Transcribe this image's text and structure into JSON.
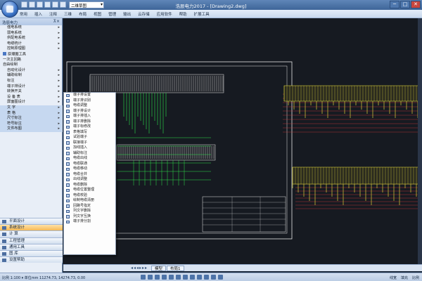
{
  "titlebar": {
    "workspace": "二维草图",
    "title": "浩辰电力2017 - [Drawing2.dwg]",
    "controls": [
      "─",
      "□",
      "✕"
    ]
  },
  "menubar": {
    "items": [
      "常用",
      "插入",
      "注释",
      "三维",
      "布局",
      "视图",
      "管理",
      "输出",
      "云存储",
      "应用软件",
      "帮助",
      "扩展工具"
    ]
  },
  "left_panel": {
    "title": "浩辰电力",
    "tree": [
      {
        "label": "强电系统",
        "arrow": true,
        "indent": true
      },
      {
        "label": "弱电系统",
        "arrow": true,
        "indent": true
      },
      {
        "label": "供配电系统",
        "arrow": true,
        "indent": true
      },
      {
        "label": "电缆统计",
        "arrow": true,
        "indent": true
      },
      {
        "label": "控制原理图",
        "arrow": true,
        "indent": true
      },
      {
        "label": "原理图工具",
        "arrow": false,
        "indent": false,
        "icon": true
      },
      {
        "label": "一次主回路",
        "arrow": false,
        "indent": false
      },
      {
        "label": "自由绘制",
        "arrow": false,
        "indent": false
      },
      {
        "label": "自动化设计",
        "arrow": true,
        "indent": true
      },
      {
        "label": "辅助绘制",
        "arrow": true,
        "indent": true
      },
      {
        "label": "标注",
        "arrow": true,
        "indent": true
      },
      {
        "label": "端子排设计",
        "arrow": true,
        "indent": true
      },
      {
        "label": "转换开关",
        "arrow": true,
        "indent": true
      },
      {
        "label": "设 备 表",
        "arrow": true,
        "indent": true
      },
      {
        "label": "屏面图设计",
        "arrow": true,
        "indent": true
      },
      {
        "label": "文     字",
        "arrow": true,
        "indent": true,
        "hl": true
      },
      {
        "label": "表     格",
        "arrow": true,
        "indent": true,
        "hl": true
      },
      {
        "label": "尺寸标注",
        "arrow": true,
        "indent": true,
        "hl": true
      },
      {
        "label": "符号标注",
        "arrow": true,
        "indent": true,
        "hl": true
      },
      {
        "label": "文件布图",
        "arrow": true,
        "indent": true,
        "hl": true
      }
    ],
    "sections": [
      {
        "label": "平面设计",
        "active": false
      },
      {
        "label": "系统设计",
        "active": true
      },
      {
        "label": "计     算",
        "active": false
      },
      {
        "label": "工程管理",
        "active": false
      },
      {
        "label": "通用工具",
        "active": false
      },
      {
        "label": "图     库",
        "active": false
      },
      {
        "label": "设置帮助",
        "active": false
      }
    ]
  },
  "flyout": {
    "items": [
      "端子排设置",
      "端子排识别",
      "电缆调整",
      "端子排设计",
      "端子排插入",
      "端子排删除",
      "端子标修改",
      "表格填写",
      "试验端子",
      "联接端子",
      "加线插入",
      "辅助标注",
      "电缆出线",
      "电缆联通",
      "电缆移动",
      "电缆合并",
      "出线调整",
      "电缆删除",
      "电缆位置整理",
      "电缆校验",
      "绘制电缆清册",
      "回路号指定",
      "列文字删除",
      "列文字互换",
      "端子排分割"
    ]
  },
  "layout_tabs": {
    "nav": "◂◂◂▸▸▸",
    "tabs": [
      "模型",
      "布局1"
    ]
  },
  "statusbar": {
    "text": "比例 1:100 ▾  单位mm  11274.73, 14274.73, 0.00",
    "right": [
      "线宽",
      "填充",
      "比例"
    ]
  },
  "colors": {
    "title_bar": "#4a71a6",
    "canvas_bg": "#161a21",
    "wire_green": "#2ee24a",
    "wire_red": "#d83a3a",
    "symbol_yellow": "#d8cf3a",
    "drawing_white": "#e6e6e6"
  }
}
